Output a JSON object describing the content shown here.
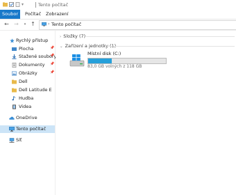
{
  "titlebar": {
    "path": "Tento počítač"
  },
  "ribbon": {
    "tabs": [
      "Soubor",
      "Počítač",
      "Zobrazení"
    ]
  },
  "addressbar": {
    "location": "Tento počítač"
  },
  "sidebar": {
    "quick_access": "Rychlý přístup",
    "items": [
      {
        "label": "Plocha"
      },
      {
        "label": "Stažené soubory"
      },
      {
        "label": "Dokumenty"
      },
      {
        "label": "Obrázky"
      },
      {
        "label": "Dell"
      },
      {
        "label": "Dell Latitude E"
      },
      {
        "label": "Hudba"
      },
      {
        "label": "Videa"
      }
    ],
    "onedrive": "OneDrive",
    "this_pc": "Tento počítač",
    "network": "Síť"
  },
  "content": {
    "folders_group": "Složky (7)",
    "devices_group": "Zařízení a jednotky (1)",
    "drive": {
      "name": "Místní disk (C:)",
      "free_text": "83,0 GB volných z 118 GB",
      "used_fraction": 0.3
    }
  },
  "colors": {
    "accent": "#1979ca",
    "selection": "#cce4f7",
    "drive_bar": "#26a0da"
  }
}
